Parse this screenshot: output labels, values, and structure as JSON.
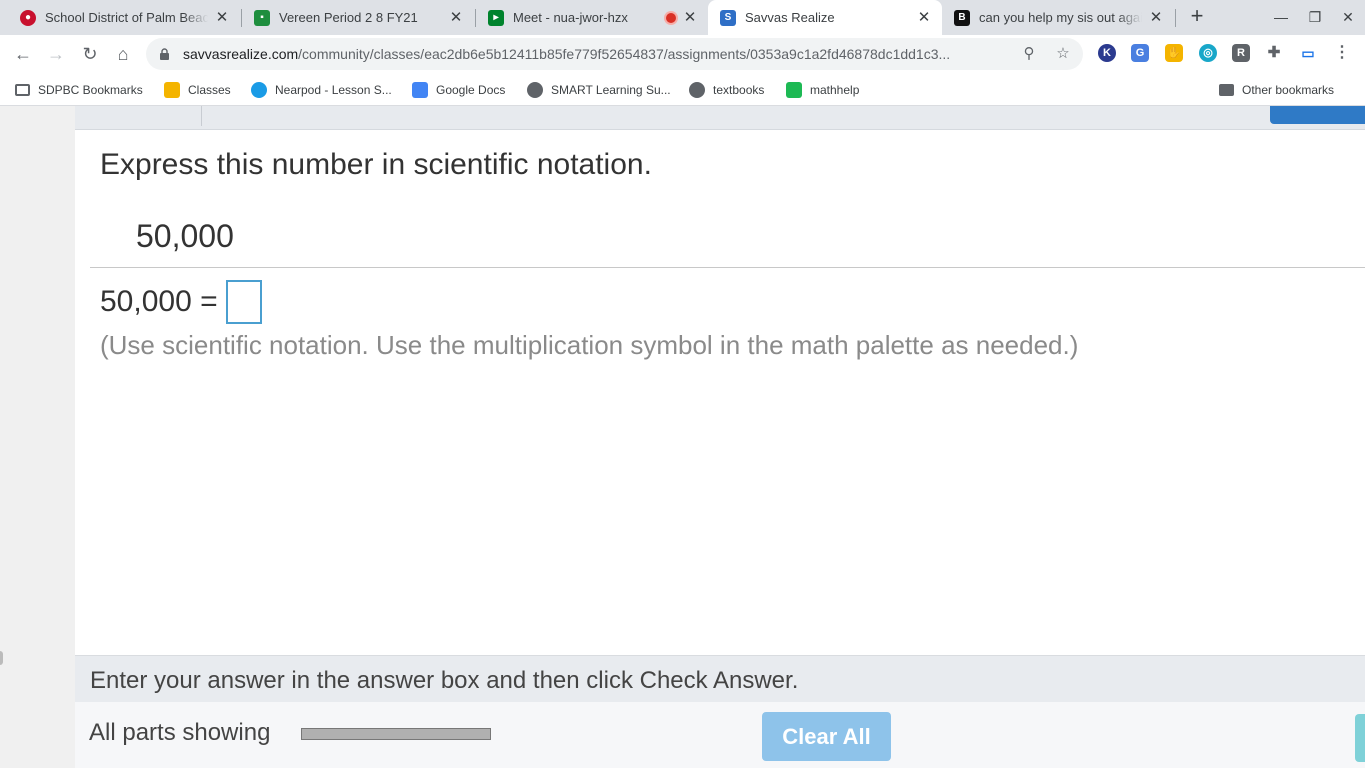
{
  "browser": {
    "tabs": [
      {
        "title": "School District of Palm Beach",
        "favicon": "sdpbc-icon",
        "color": "#c8102e",
        "active": false
      },
      {
        "title": "Vereen Period 2 8 FY21",
        "favicon": "classroom-icon",
        "color": "#1e8e3e",
        "active": false
      },
      {
        "title": "Meet - nua-jwor-hzx",
        "favicon": "meet-icon",
        "color": "#00832d",
        "active": false,
        "recording": true
      },
      {
        "title": "Savvas Realize",
        "favicon": "savvas-icon",
        "color": "#2f6fc6",
        "active": true
      },
      {
        "title": "can you help my sis out again",
        "favicon": "brainly-icon",
        "color": "#111111",
        "active": false
      }
    ],
    "url_host": "savvasrealize.com",
    "url_path": "/community/classes/eac2db6e5b12411b85fe779f52654837/assignments/0353a9c1a2fd46878dc1dd1c3...",
    "bookmarks": [
      {
        "label": "SDPBC Bookmarks",
        "icon": "folder-icon"
      },
      {
        "label": "Classes",
        "icon": "classroom-icon"
      },
      {
        "label": "Nearpod - Lesson S...",
        "icon": "nearpod-icon"
      },
      {
        "label": "Google Docs",
        "icon": "docs-icon"
      },
      {
        "label": "SMART Learning Su...",
        "icon": "globe-icon"
      },
      {
        "label": "textbooks",
        "icon": "globe-icon"
      },
      {
        "label": "mathhelp",
        "icon": "mathhelp-icon"
      }
    ],
    "other_bookmarks": "Other bookmarks"
  },
  "exercise": {
    "question": "Express this number in scientific notation.",
    "given_number": "50,000",
    "equation_lhs": "50,000 =",
    "answer_value": "",
    "hint": "(Use scientific notation. Use the multiplication symbol in the math palette as needed.)",
    "instruction": "Enter your answer in the answer box and then click Check Answer.",
    "parts_label": "All parts showing",
    "progress_fraction": 1.0,
    "clear_button": "Clear All"
  }
}
